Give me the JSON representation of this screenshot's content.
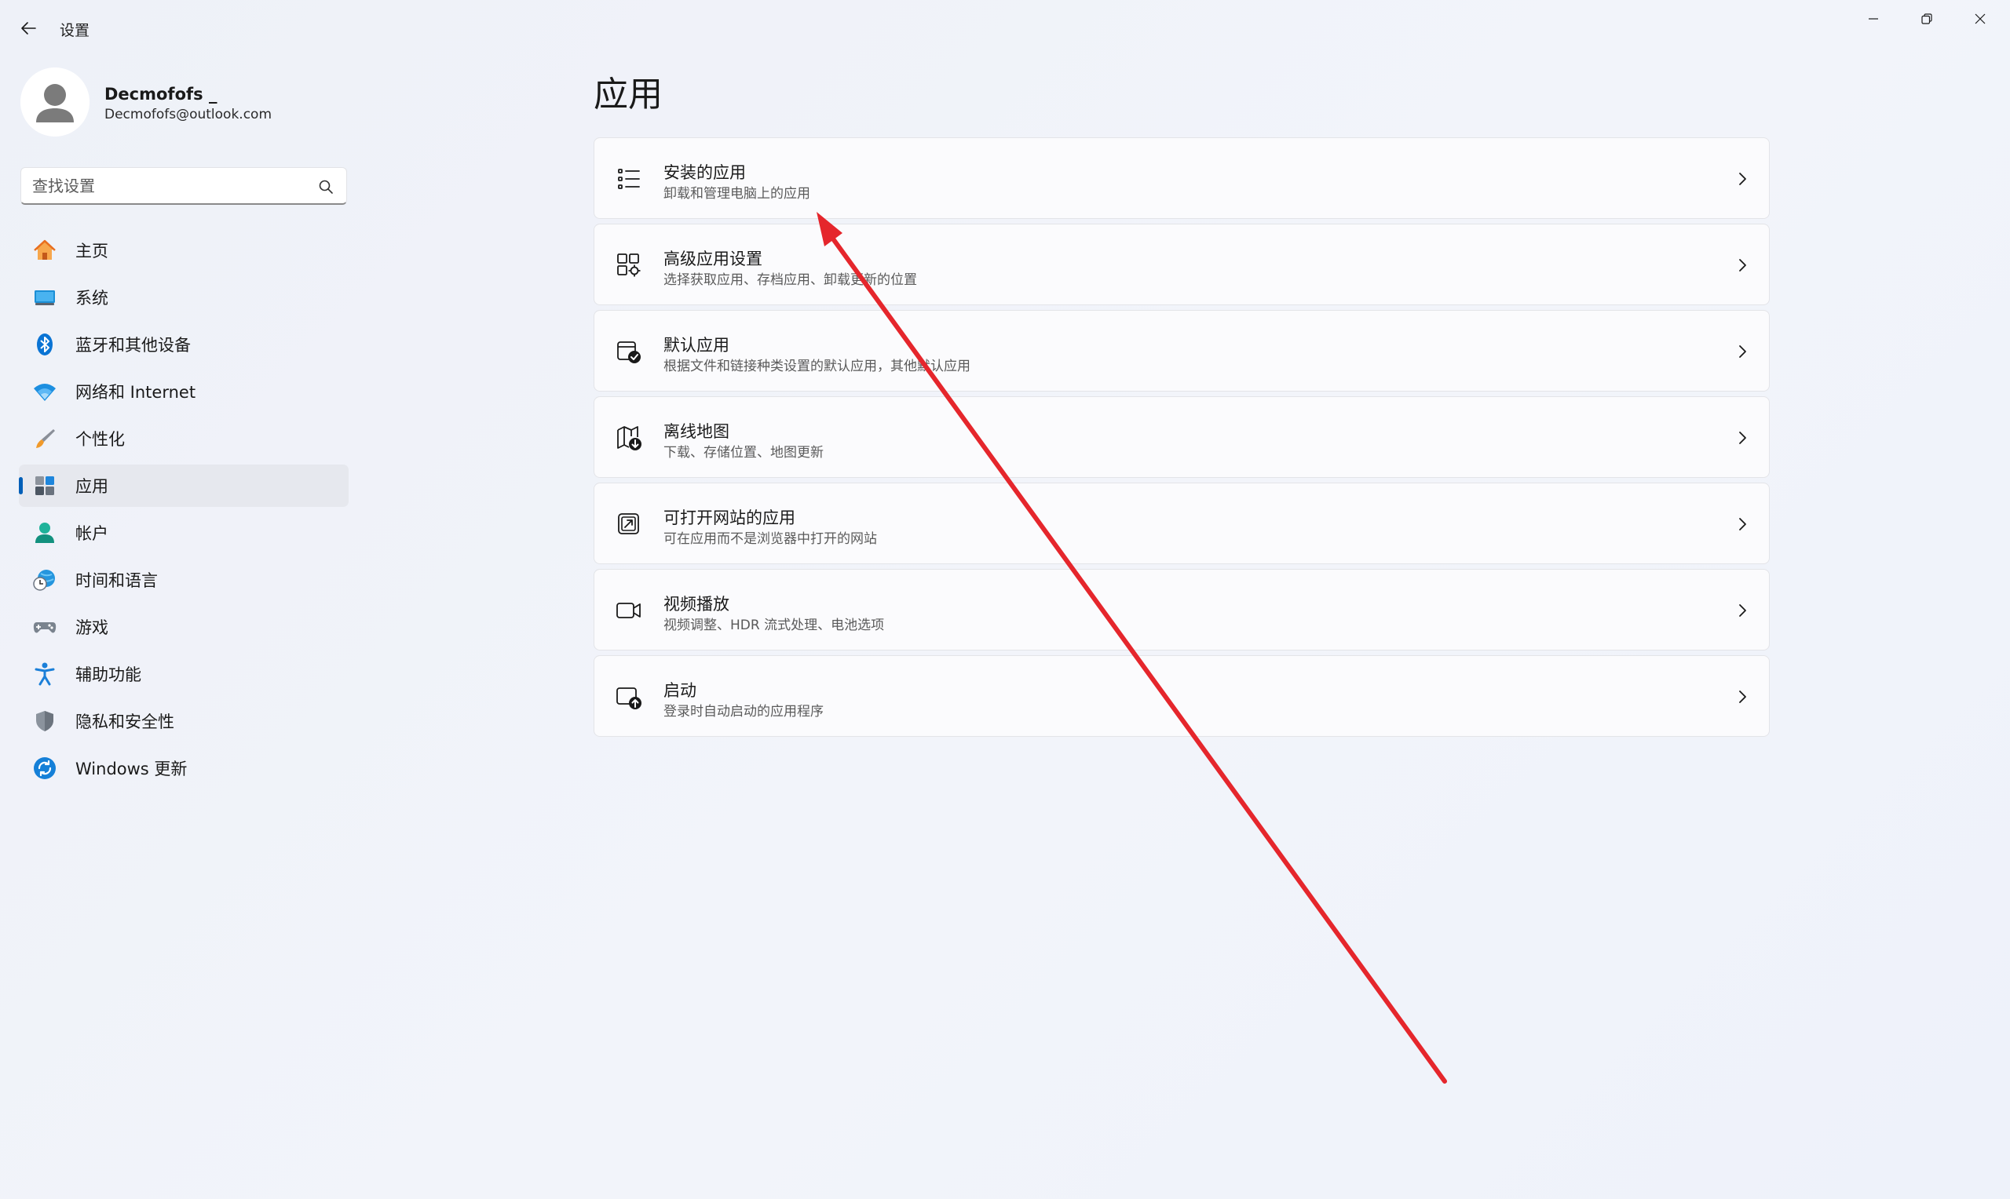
{
  "window": {
    "title": "设置",
    "controls": [
      "minimize",
      "maximize",
      "close"
    ]
  },
  "user": {
    "name": "Decmofofs _",
    "email": "Decmofofs@outlook.com"
  },
  "search": {
    "placeholder": "查找设置",
    "value": ""
  },
  "nav": {
    "selected_index": 5,
    "items": [
      {
        "label": "主页",
        "icon": "home-icon"
      },
      {
        "label": "系统",
        "icon": "system-display-icon"
      },
      {
        "label": "蓝牙和其他设备",
        "icon": "bluetooth-icon"
      },
      {
        "label": "网络和 Internet",
        "icon": "wifi-icon"
      },
      {
        "label": "个性化",
        "icon": "brush-icon"
      },
      {
        "label": "应用",
        "icon": "apps-icon"
      },
      {
        "label": "帐户",
        "icon": "account-icon"
      },
      {
        "label": "时间和语言",
        "icon": "time-language-icon"
      },
      {
        "label": "游戏",
        "icon": "gamepad-icon"
      },
      {
        "label": "辅助功能",
        "icon": "accessibility-icon"
      },
      {
        "label": "隐私和安全性",
        "icon": "shield-icon"
      },
      {
        "label": "Windows 更新",
        "icon": "windows-update-icon"
      }
    ]
  },
  "main": {
    "title": "应用",
    "cards": [
      {
        "title": "安装的应用",
        "desc": "卸载和管理电脑上的应用",
        "icon": "installed-apps-list-icon"
      },
      {
        "title": "高级应用设置",
        "desc": "选择获取应用、存档应用、卸载更新的位置",
        "icon": "advanced-app-settings-icon"
      },
      {
        "title": "默认应用",
        "desc": "根据文件和链接种类设置的默认应用，其他默认应用",
        "icon": "default-apps-icon"
      },
      {
        "title": "离线地图",
        "desc": "下载、存储位置、地图更新",
        "icon": "offline-maps-icon"
      },
      {
        "title": "可打开网站的应用",
        "desc": "可在应用而不是浏览器中打开的网站",
        "icon": "apps-for-websites-icon"
      },
      {
        "title": "视频播放",
        "desc": "视频调整、HDR 流式处理、电池选项",
        "icon": "video-camera-icon"
      },
      {
        "title": "启动",
        "desc": "登录时自动启动的应用程序",
        "icon": "startup-icon"
      }
    ]
  },
  "colors": {
    "accent": "#005fb8",
    "annotation_arrow": "#e5262c",
    "background": "#eef1f8",
    "card": "#fbfbfd"
  }
}
